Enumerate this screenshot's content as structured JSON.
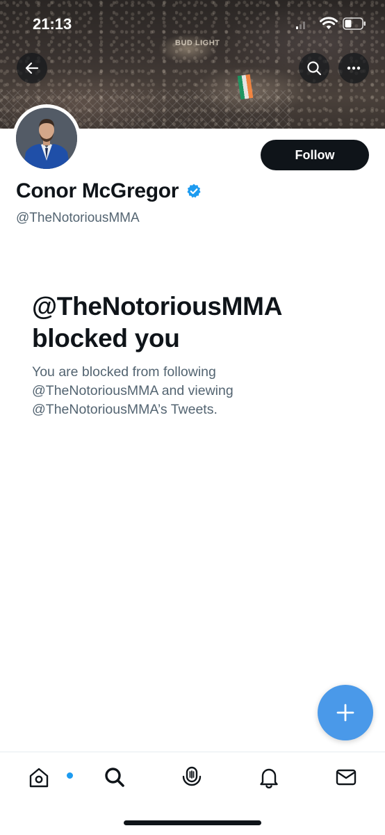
{
  "status_bar": {
    "time": "21:13"
  },
  "header": {
    "banner_sign": "BUD LIGHT"
  },
  "profile": {
    "display_name": "Conor McGregor",
    "handle": "@TheNotoriousMMA",
    "verified": true,
    "follow_label": "Follow"
  },
  "blocked": {
    "title_line1": "@TheNotoriousMMA",
    "title_line2": "blocked you",
    "description_line1": "You are blocked from following",
    "description_line2": "@TheNotoriousMMA and viewing",
    "description_line3": "@TheNotoriousMMA’s Tweets."
  },
  "icons": {
    "back": "arrow-left-icon",
    "search": "search-icon",
    "more": "more-horizontal-icon",
    "compose": "plus-icon",
    "home": "home-icon",
    "explore": "search-icon",
    "spaces": "microphone-icon",
    "notifications": "bell-icon",
    "messages": "envelope-icon"
  },
  "colors": {
    "accent": "#1d9bf0",
    "fab": "#4a99e9",
    "text_primary": "#0f1419",
    "text_secondary": "#536471"
  }
}
